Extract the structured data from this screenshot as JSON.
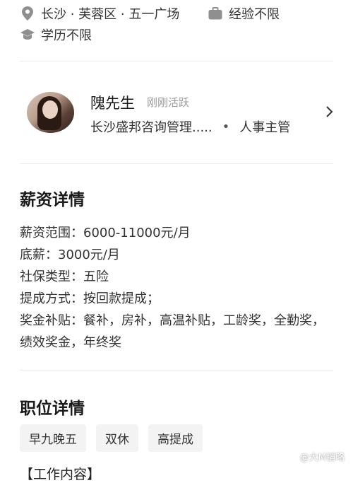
{
  "job_meta": {
    "location": "长沙 · 芙蓉区 · 五一广场",
    "experience": "经验不限",
    "education": "学历不限"
  },
  "recruiter": {
    "name": "隗先生",
    "status": "刚刚活跃",
    "company": "长沙盛邦咨询管理.....",
    "separator": "•",
    "role": "人事主管"
  },
  "salary_section": {
    "title": "薪资详情",
    "lines": [
      "薪资范围：6000-11000元/月",
      "底薪：3000元/月",
      "社保类型：五险",
      "提成方式：按回款提成；",
      "奖金补贴：餐补，房补，高温补贴，工龄奖，全勤奖，绩效奖金，年终奖"
    ]
  },
  "position_section": {
    "title": "职位详情",
    "tags": [
      "早九晚五",
      "双休",
      "高提成"
    ],
    "partial_text": "【工作内容】"
  },
  "watermark": "@大M韬略",
  "colors": {
    "text_primary": "#1a1a1a",
    "text_secondary": "#9a9a9a",
    "tag_bg": "#f3f3f3",
    "divider": "#ececec"
  }
}
